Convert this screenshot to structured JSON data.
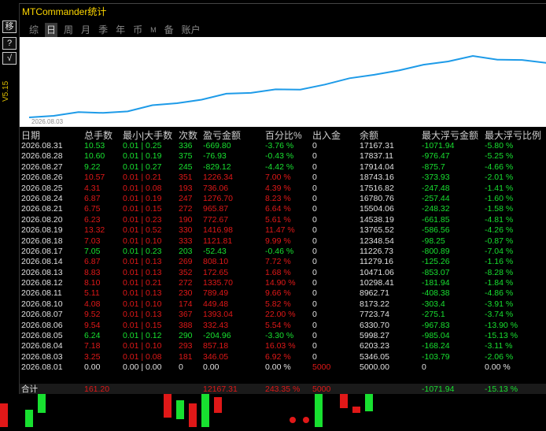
{
  "window": {
    "title": "MTCommander统计"
  },
  "left": {
    "buttons": [
      {
        "label": "移",
        "name": "move-button"
      },
      {
        "label": "?",
        "name": "help-button"
      },
      {
        "label": "√",
        "name": "confirm-button"
      }
    ],
    "version": "V5.15"
  },
  "tabs": [
    {
      "label": "综",
      "active": false,
      "small": false
    },
    {
      "label": "日",
      "active": true,
      "small": false
    },
    {
      "label": "周",
      "active": false,
      "small": false
    },
    {
      "label": "月",
      "active": false,
      "small": false
    },
    {
      "label": "季",
      "active": false,
      "small": false
    },
    {
      "label": "年",
      "active": false,
      "small": false
    },
    {
      "label": "币",
      "active": false,
      "small": false
    },
    {
      "label": "M",
      "active": false,
      "small": true
    },
    {
      "label": "备",
      "active": false,
      "small": false
    },
    {
      "label": "账户",
      "active": false,
      "small": false
    }
  ],
  "chart_data": {
    "type": "line",
    "x_label_start": "2026.08.03",
    "series": [
      {
        "values": [
          5000,
          5346.05,
          6203.23,
          5998.27,
          6330.7,
          7723.74,
          8173.22,
          8962.71,
          10298.41,
          10471.06,
          11279.16,
          11226.73,
          12348.54,
          13765.52,
          14538.19,
          15504.06,
          16780.76,
          17516.82,
          18743.16,
          17914.04,
          17837.11,
          17167.31
        ]
      }
    ],
    "line_color": "#1e9be8"
  },
  "table": {
    "headers": [
      "日期",
      "总手数",
      "最小|大手数",
      "次数",
      "盈亏金额",
      "百分比%",
      "出入金",
      "余额",
      "最大浮亏金额",
      "最大浮亏比例"
    ],
    "rows": [
      {
        "date": "2026.08.31",
        "lots": "10.53",
        "minmax": "0.01 | 0.25",
        "count": "336",
        "pnl": "-669.80",
        "pct": "-3.76 %",
        "io": "0",
        "balance": "17167.31",
        "maxdd": "-1071.94",
        "maxddpct": "-5.80 %",
        "sign": "neg"
      },
      {
        "date": "2026.08.28",
        "lots": "10.60",
        "minmax": "0.01 | 0.19",
        "count": "375",
        "pnl": "-76.93",
        "pct": "-0.43 %",
        "io": "0",
        "balance": "17837.11",
        "maxdd": "-976.47",
        "maxddpct": "-5.25 %",
        "sign": "neg"
      },
      {
        "date": "2026.08.27",
        "lots": "9.22",
        "minmax": "0.01 | 0.27",
        "count": "245",
        "pnl": "-829.12",
        "pct": "-4.42 %",
        "io": "0",
        "balance": "17914.04",
        "maxdd": "-875.7",
        "maxddpct": "-4.66 %",
        "sign": "neg"
      },
      {
        "date": "2026.08.26",
        "lots": "10.57",
        "minmax": "0.01 | 0.21",
        "count": "351",
        "pnl": "1226.34",
        "pct": "7.00 %",
        "io": "0",
        "balance": "18743.16",
        "maxdd": "-373.93",
        "maxddpct": "-2.01 %",
        "sign": "pos"
      },
      {
        "date": "2026.08.25",
        "lots": "4.31",
        "minmax": "0.01 | 0.08",
        "count": "193",
        "pnl": "736.06",
        "pct": "4.39 %",
        "io": "0",
        "balance": "17516.82",
        "maxdd": "-247.48",
        "maxddpct": "-1.41 %",
        "sign": "pos"
      },
      {
        "date": "2026.08.24",
        "lots": "6.87",
        "minmax": "0.01 | 0.19",
        "count": "247",
        "pnl": "1276.70",
        "pct": "8.23 %",
        "io": "0",
        "balance": "16780.76",
        "maxdd": "-257.44",
        "maxddpct": "-1.60 %",
        "sign": "pos"
      },
      {
        "date": "2026.08.21",
        "lots": "6.75",
        "minmax": "0.01 | 0.15",
        "count": "272",
        "pnl": "965.87",
        "pct": "6.64 %",
        "io": "0",
        "balance": "15504.06",
        "maxdd": "-248.32",
        "maxddpct": "-1.58 %",
        "sign": "pos"
      },
      {
        "date": "2026.08.20",
        "lots": "6.23",
        "minmax": "0.01 | 0.23",
        "count": "190",
        "pnl": "772.67",
        "pct": "5.61 %",
        "io": "0",
        "balance": "14538.19",
        "maxdd": "-661.85",
        "maxddpct": "-4.81 %",
        "sign": "pos"
      },
      {
        "date": "2026.08.19",
        "lots": "13.32",
        "minmax": "0.01 | 0.52",
        "count": "330",
        "pnl": "1416.98",
        "pct": "11.47 %",
        "io": "0",
        "balance": "13765.52",
        "maxdd": "-586.56",
        "maxddpct": "-4.26 %",
        "sign": "pos"
      },
      {
        "date": "2026.08.18",
        "lots": "7.03",
        "minmax": "0.01 | 0.10",
        "count": "333",
        "pnl": "1121.81",
        "pct": "9.99 %",
        "io": "0",
        "balance": "12348.54",
        "maxdd": "-98.25",
        "maxddpct": "-0.87 %",
        "sign": "pos"
      },
      {
        "date": "2026.08.17",
        "lots": "7.05",
        "minmax": "0.01 | 0.23",
        "count": "203",
        "pnl": "-52.43",
        "pct": "-0.46 %",
        "io": "0",
        "balance": "11226.73",
        "maxdd": "-800.89",
        "maxddpct": "-7.04 %",
        "sign": "neg"
      },
      {
        "date": "2026.08.14",
        "lots": "6.87",
        "minmax": "0.01 | 0.13",
        "count": "269",
        "pnl": "808.10",
        "pct": "7.72 %",
        "io": "0",
        "balance": "11279.16",
        "maxdd": "-125.26",
        "maxddpct": "-1.16 %",
        "sign": "pos"
      },
      {
        "date": "2026.08.13",
        "lots": "8.83",
        "minmax": "0.01 | 0.13",
        "count": "352",
        "pnl": "172.65",
        "pct": "1.68 %",
        "io": "0",
        "balance": "10471.06",
        "maxdd": "-853.07",
        "maxddpct": "-8.28 %",
        "sign": "pos"
      },
      {
        "date": "2026.08.12",
        "lots": "8.10",
        "minmax": "0.01 | 0.21",
        "count": "272",
        "pnl": "1335.70",
        "pct": "14.90 %",
        "io": "0",
        "balance": "10298.41",
        "maxdd": "-181.94",
        "maxddpct": "-1.84 %",
        "sign": "pos"
      },
      {
        "date": "2026.08.11",
        "lots": "5.11",
        "minmax": "0.01 | 0.13",
        "count": "230",
        "pnl": "789.49",
        "pct": "9.66 %",
        "io": "0",
        "balance": "8962.71",
        "maxdd": "-408.38",
        "maxddpct": "-4.86 %",
        "sign": "pos"
      },
      {
        "date": "2026.08.10",
        "lots": "4.08",
        "minmax": "0.01 | 0.10",
        "count": "174",
        "pnl": "449.48",
        "pct": "5.82 %",
        "io": "0",
        "balance": "8173.22",
        "maxdd": "-303.4",
        "maxddpct": "-3.91 %",
        "sign": "pos"
      },
      {
        "date": "2026.08.07",
        "lots": "9.52",
        "minmax": "0.01 | 0.13",
        "count": "367",
        "pnl": "1393.04",
        "pct": "22.00 %",
        "io": "0",
        "balance": "7723.74",
        "maxdd": "-275.1",
        "maxddpct": "-3.74 %",
        "sign": "pos"
      },
      {
        "date": "2026.08.06",
        "lots": "9.54",
        "minmax": "0.01 | 0.15",
        "count": "388",
        "pnl": "332.43",
        "pct": "5.54 %",
        "io": "0",
        "balance": "6330.70",
        "maxdd": "-967.83",
        "maxddpct": "-13.90 %",
        "sign": "pos"
      },
      {
        "date": "2026.08.05",
        "lots": "6.24",
        "minmax": "0.01 | 0.12",
        "count": "290",
        "pnl": "-204.96",
        "pct": "-3.30 %",
        "io": "0",
        "balance": "5998.27",
        "maxdd": "-985.04",
        "maxddpct": "-15.13 %",
        "sign": "neg"
      },
      {
        "date": "2026.08.04",
        "lots": "7.18",
        "minmax": "0.01 | 0.10",
        "count": "293",
        "pnl": "857.18",
        "pct": "16.03 %",
        "io": "0",
        "balance": "6203.23",
        "maxdd": "-168.24",
        "maxddpct": "-3.11 %",
        "sign": "pos"
      },
      {
        "date": "2026.08.03",
        "lots": "3.25",
        "minmax": "0.01 | 0.08",
        "count": "181",
        "pnl": "346.05",
        "pct": "6.92 %",
        "io": "0",
        "balance": "5346.05",
        "maxdd": "-103.79",
        "maxddpct": "-2.06 %",
        "sign": "pos"
      },
      {
        "date": "2026.08.01",
        "lots": "0.00",
        "minmax": "0.00 | 0.00",
        "count": "0",
        "pnl": "0.00",
        "pct": "0.00 %",
        "io": "5000",
        "balance": "5000.00",
        "maxdd": "0",
        "maxddpct": "0.00 %",
        "sign": "zero"
      }
    ],
    "total": {
      "label": "合计",
      "lots": "161.20",
      "pnl": "12167.31",
      "pct": "243.35 %",
      "io": "5000",
      "maxdd": "-1071.94",
      "maxddpct": "-15.13 %"
    }
  },
  "colors": {
    "positive": "#e01818",
    "negative": "#18e030",
    "title": "#ffd800",
    "line": "#1e9be8"
  }
}
